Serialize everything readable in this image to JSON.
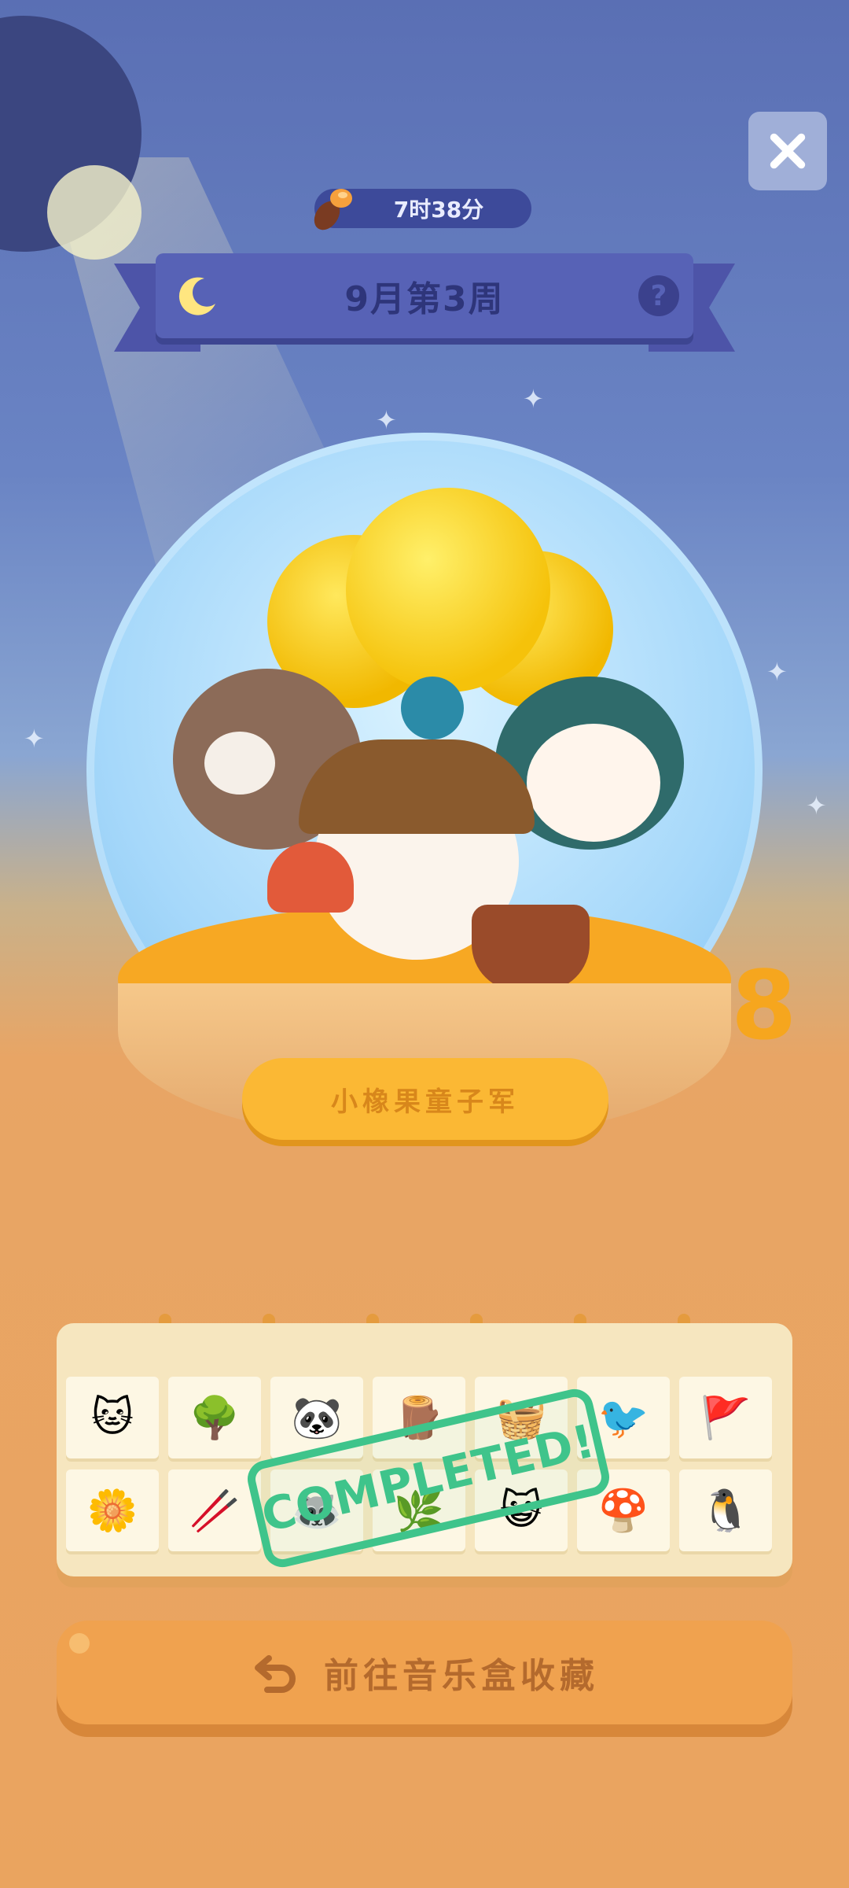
{
  "header": {
    "timer_text": "7时38分",
    "banner_title": "9月第3周"
  },
  "globe": {
    "plaque_text": "小橡果童子军",
    "side_number": "8"
  },
  "collection": {
    "stamp_text": "COMPLETED!",
    "items": [
      "🐱",
      "🌳",
      "🐼",
      "🪵",
      "🧺",
      "🐦",
      "🚩",
      "🌼",
      "🥢",
      "🦝",
      "🌿",
      "😺",
      "🍄",
      "🐧"
    ]
  },
  "action": {
    "label": "前往音乐盒收藏"
  },
  "colors": {
    "sky_top": "#5a6fb4",
    "ground": "#eaa45f",
    "banner": "#5762b6",
    "stamp_green": "#3fc48b",
    "button_orange": "#f0a24f"
  }
}
